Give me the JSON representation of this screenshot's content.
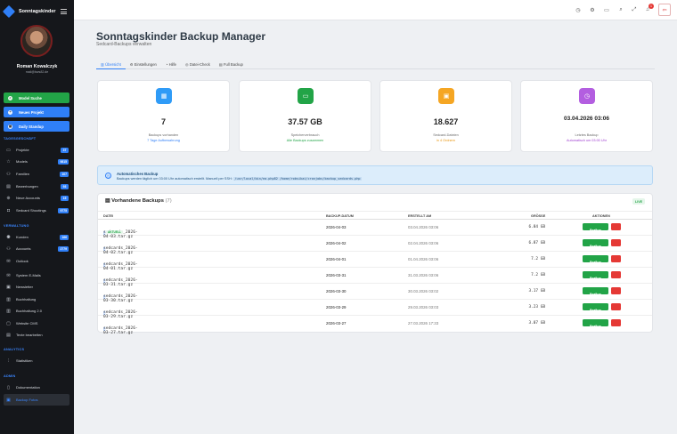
{
  "brand": {
    "name": "Sonntagskinder"
  },
  "user": {
    "name": "Roman Kowalczyk",
    "email": "mail@bws82.de"
  },
  "quick": [
    {
      "label": "Model Suche",
      "icon": "search-icon"
    },
    {
      "label": "Neues Projekt",
      "icon": "plus-icon"
    },
    {
      "label": "Daily Standup",
      "icon": "calendar-icon"
    }
  ],
  "sections": {
    "tagesgeschaeft": "TAGESGESCHÄFT",
    "verwaltung": "VERWALTUNG",
    "analytics": "ANALYTICS",
    "admin": "ADMIN"
  },
  "nav_tages": [
    {
      "label": "Projekte",
      "icon": "folder-icon",
      "badge": "37"
    },
    {
      "label": "Models",
      "icon": "star-icon",
      "badge": "9815"
    },
    {
      "label": "Familien",
      "icon": "family-icon",
      "badge": "107"
    },
    {
      "label": "Bewerbungen",
      "icon": "document-icon",
      "badge": "93"
    },
    {
      "label": "Neue Accounts",
      "icon": "user-plus-icon",
      "badge": "15"
    },
    {
      "label": "Sedcard Shootings",
      "icon": "camera-icon",
      "badge": "9775"
    }
  ],
  "nav_verwaltung": [
    {
      "label": "Kunden",
      "icon": "users-icon",
      "badge": "166"
    },
    {
      "label": "Accounts",
      "icon": "user-icon",
      "badge": "2779"
    },
    {
      "label": "Outlook",
      "icon": "mail-icon",
      "badge": ""
    },
    {
      "label": "System E-Mails",
      "icon": "envelope-icon",
      "badge": ""
    },
    {
      "label": "Newsletter",
      "icon": "newsletter-icon",
      "badge": ""
    },
    {
      "label": "Buchhaltung",
      "icon": "ledger-icon",
      "badge": ""
    },
    {
      "label": "Buchhaltung 2.0",
      "icon": "ledger-icon",
      "badge": ""
    },
    {
      "label": "Website CMS",
      "icon": "monitor-icon",
      "badge": ""
    },
    {
      "label": "Texte bearbeiten",
      "icon": "text-icon",
      "badge": ""
    }
  ],
  "nav_analytics": [
    {
      "label": "Statistiken",
      "icon": "chart-icon"
    }
  ],
  "nav_admin": [
    {
      "label": "Dokumentation",
      "icon": "book-icon"
    },
    {
      "label": "Backup Fotos",
      "icon": "backup-icon"
    }
  ],
  "topbar": {
    "notif_count": "1"
  },
  "page": {
    "title": "Sonntagskinder Backup Manager",
    "subtitle": "Sedcard-Backups verwalten"
  },
  "tabs": [
    {
      "label": "Übersicht",
      "icon": "chart-icon"
    },
    {
      "label": "Einstellungen",
      "icon": "gear-icon"
    },
    {
      "label": "Hilfe",
      "icon": "help-icon"
    },
    {
      "label": "Datei-Check",
      "icon": "check-icon"
    },
    {
      "label": "Full Backup",
      "icon": "archive-icon"
    }
  ],
  "cards": [
    {
      "value": "7",
      "label": "Backups vorhanden",
      "note": "7 Tage Aufbewahrung",
      "color": "#2f9bf7",
      "note_color": "#2f7ff7",
      "icon": "calendar-icon"
    },
    {
      "value": "37.57 GB",
      "label": "Speicherverbrauch",
      "note": "Alle Backups zusammen",
      "color": "#22a447",
      "note_color": "#22a447",
      "icon": "disk-icon"
    },
    {
      "value": "18.627",
      "label": "Sedcard-Dateien",
      "note": "in 4 Ordnern",
      "color": "#f5a623",
      "note_color": "#e8950f",
      "icon": "image-icon"
    },
    {
      "value": "03.04.2026 03:06",
      "label": "Letztes Backup",
      "note": "Automatisch um 03:00 Uhr",
      "color": "#b35ee0",
      "note_color": "#a040d0",
      "icon": "clock-icon"
    }
  ],
  "alert": {
    "title": "Automatisches Backup",
    "text": "Backups werden täglich um 03:00 Uhr automatisch erstellt. Manuell per SSH:",
    "code": "/usr/local/bin/ea-php82 /home/robsikai/cronjobs/backup_sedcards.php"
  },
  "table": {
    "title": "Vorhandene Backups",
    "count": "(7)",
    "live": "LIVE",
    "headers": {
      "file": "DATEI",
      "date": "BACKUP-DATUM",
      "created": "ERSTELLT AM",
      "size": "GRÖSSE",
      "actions": "AKTIONEN"
    },
    "current_badge": "AKTUELL",
    "restore_label": "Restore",
    "rows": [
      {
        "file": "sedcards_2026-04-03.tar.gz",
        "date": "2026-04-03",
        "created": "03.04.2026 03:06",
        "size": "6.84 GB"
      },
      {
        "file": "sedcards_2026-04-02.tar.gz",
        "date": "2026-04-02",
        "created": "02.04.2026 03:06",
        "size": "6.87 GB"
      },
      {
        "file": "sedcards_2026-04-01.tar.gz",
        "date": "2026-04-01",
        "created": "01.04.2026 03:06",
        "size": "7.2 GB"
      },
      {
        "file": "sedcards_2026-03-31.tar.gz",
        "date": "2026-03-31",
        "created": "31.03.2026 03:06",
        "size": "7.2 GB"
      },
      {
        "file": "sedcards_2026-03-30.tar.gz",
        "date": "2026-03-30",
        "created": "30.03.2026 03:02",
        "size": "3.17 GB"
      },
      {
        "file": "sedcards_2026-03-29.tar.gz",
        "date": "2026-03-29",
        "created": "29.03.2026 03:03",
        "size": "3.23 GB"
      },
      {
        "file": "sedcards_2026-03-27.tar.gz",
        "date": "2026-03-27",
        "created": "27.03.2026 17:33",
        "size": "3.07 GB"
      }
    ]
  }
}
